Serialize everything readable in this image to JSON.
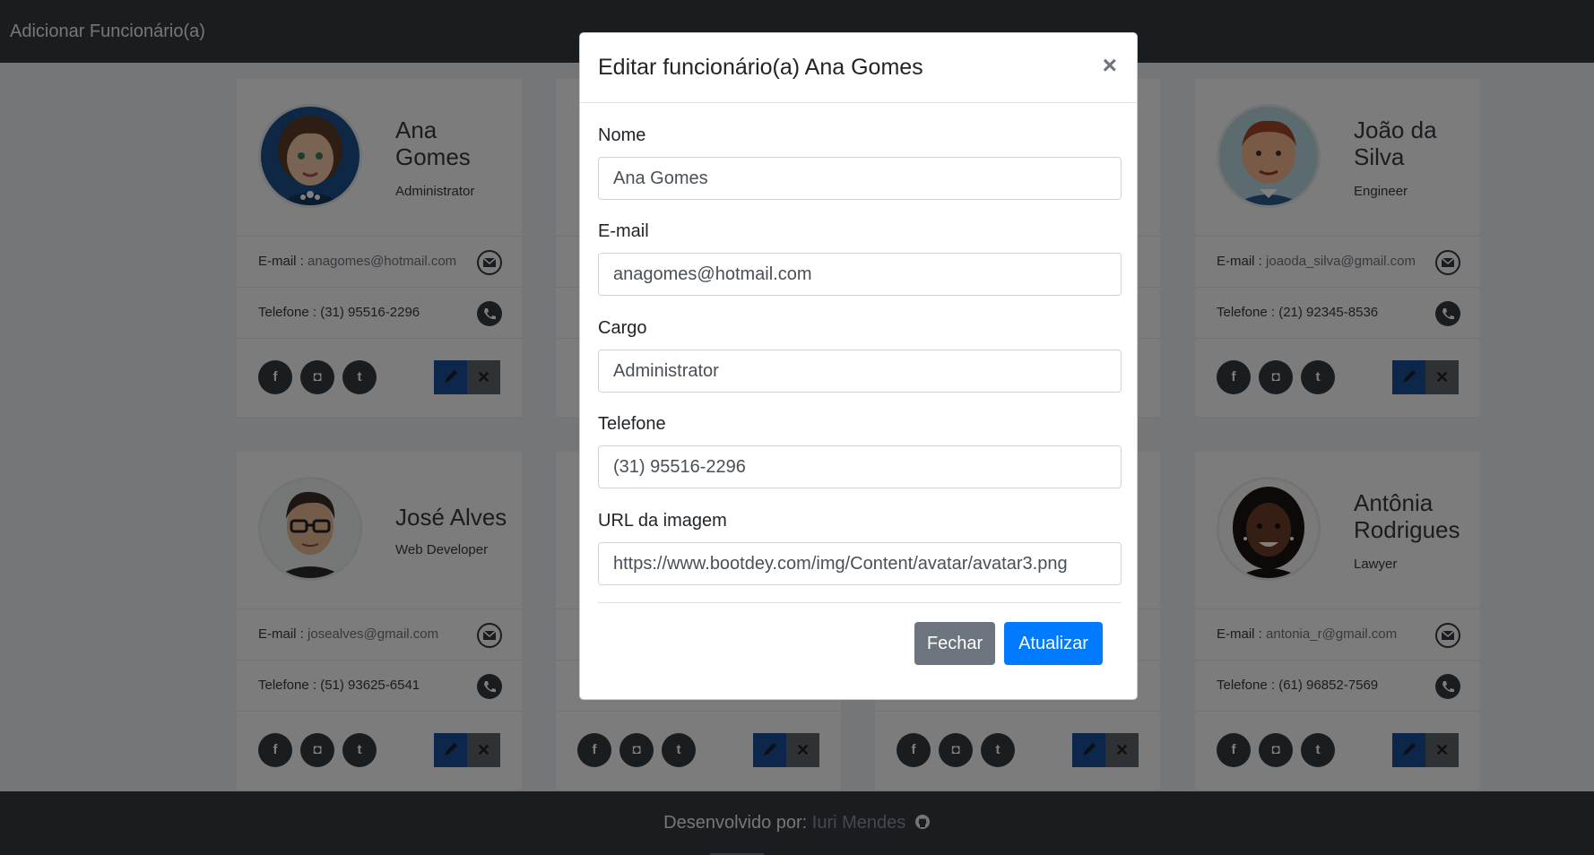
{
  "navbar": {
    "brand": "Adicionar Funcionário(a)"
  },
  "footer": {
    "prefix": "Desenvolvido por:",
    "author": "Iuri Mendes",
    "icon": "github-icon"
  },
  "cards": [
    {
      "name": "Ana Gomes",
      "role": "Administrator",
      "email_label": "E-mail :",
      "email": "anagomes@hotmail.com",
      "phone_label": "Telefone :",
      "phone": "(31) 95516-2296"
    },
    {
      "name": "João da Silva",
      "role": "Engineer",
      "email_label": "E-mail :",
      "email": "joaoda_silva@gmail.com",
      "phone_label": "Telefone :",
      "phone": "(21) 92345-8536"
    },
    {
      "name": "José Alves",
      "role": "Web Developer",
      "email_label": "E-mail :",
      "email": "josealves@gmail.com",
      "phone_label": "Telefone :",
      "phone": "(51) 93625-6541"
    },
    {
      "name": "Antônia Rodrigues",
      "role": "Lawyer",
      "email_label": "E-mail :",
      "email": "antonia_r@gmail.com",
      "phone_label": "Telefone :",
      "phone": "(61) 96852-7569"
    }
  ],
  "social_icons": {
    "facebook": "f",
    "instagram": "◘",
    "twitter": "t"
  },
  "delete_glyph": "✕",
  "modal": {
    "title": "Editar funcionário(a) Ana Gomes",
    "close_glyph": "×",
    "fields": [
      {
        "label": "Nome",
        "value": "Ana Gomes"
      },
      {
        "label": "E-mail",
        "value": "anagomes@hotmail.com"
      },
      {
        "label": "Cargo",
        "value": "Administrator"
      },
      {
        "label": "Telefone",
        "value": "(31) 95516-2296"
      },
      {
        "label": "URL da imagem",
        "value": "https://www.bootdey.com/img/Content/avatar/avatar3.png"
      }
    ],
    "close_button": "Fechar",
    "update_button": "Atualizar"
  },
  "colors": {
    "primary": "#007bff",
    "secondary": "#6c757d",
    "dark": "#343a40"
  }
}
